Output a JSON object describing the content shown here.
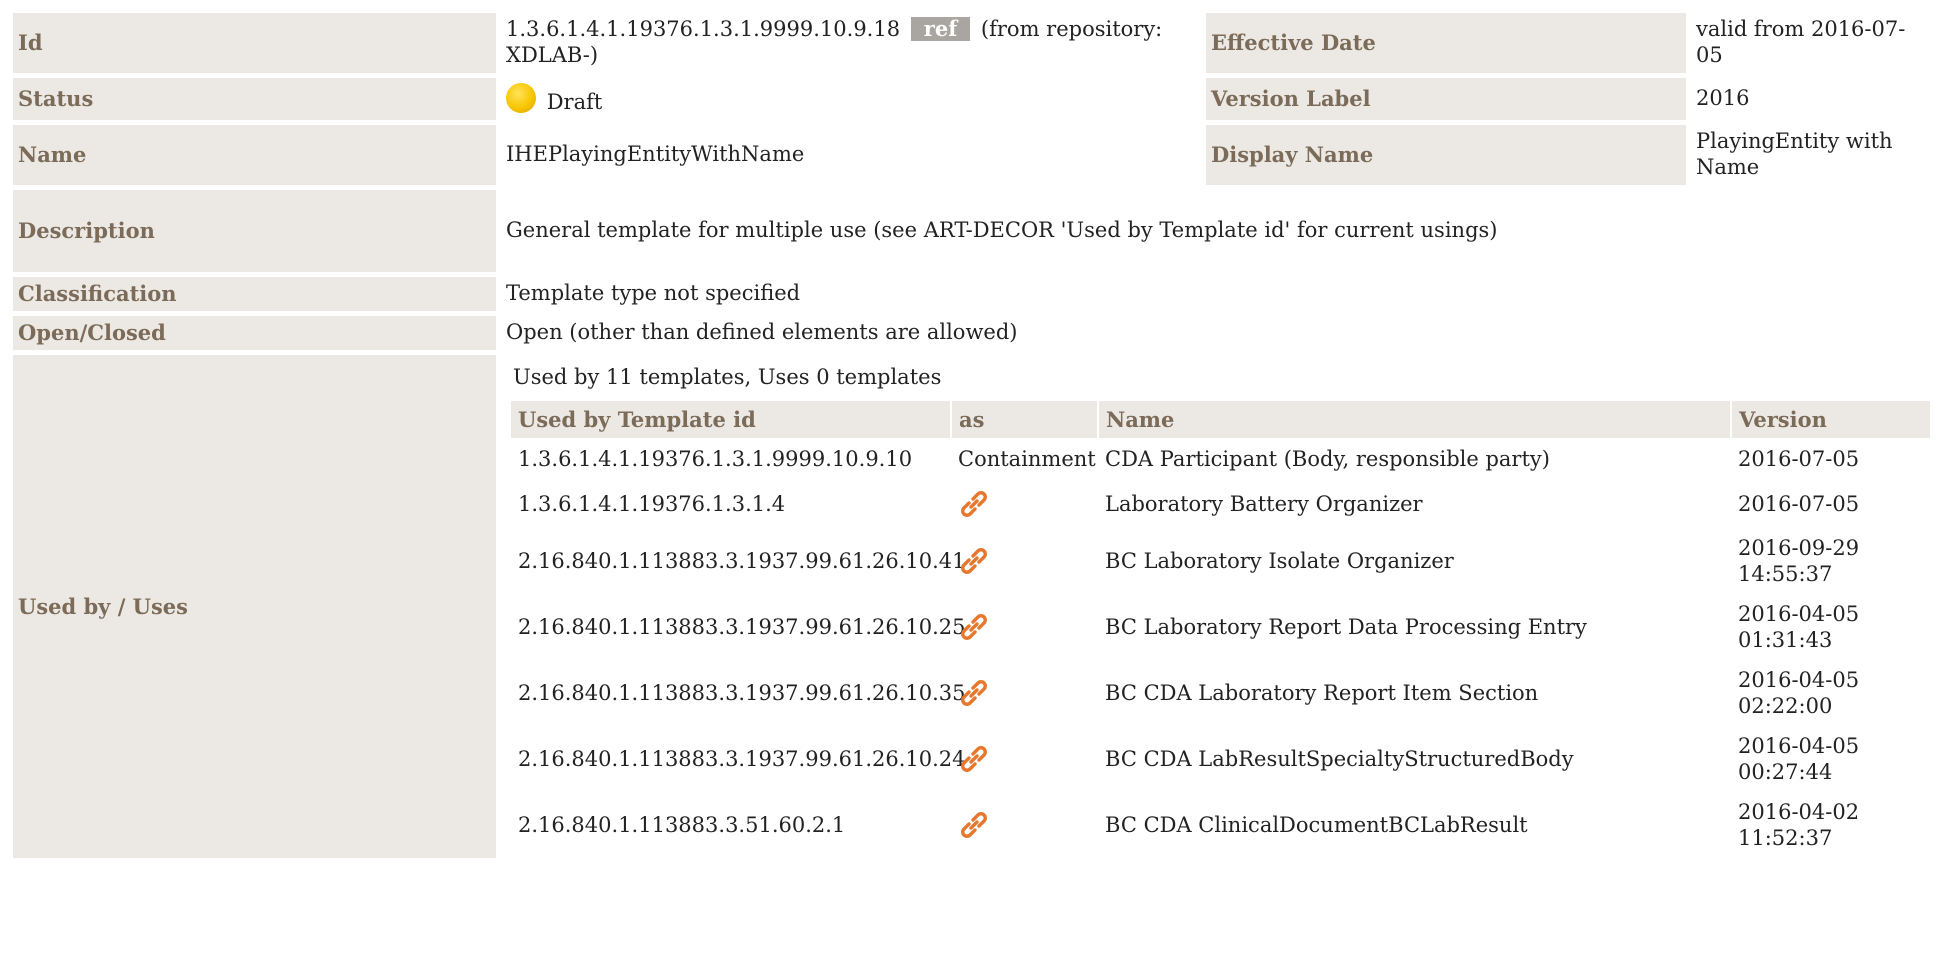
{
  "rows": {
    "id": {
      "label": "Id",
      "value": "1.3.6.1.4.1.19376.1.3.1.9999.10.9.18",
      "badge": "ref",
      "suffix": "(from repository: XDLAB-)"
    },
    "effective_date": {
      "label": "Effective Date",
      "value": "valid from 2016-07-05"
    },
    "status": {
      "label": "Status",
      "value": "Draft",
      "icon": "draft-status-icon",
      "icon_color": "#f7c600"
    },
    "version_label": {
      "label": "Version Label",
      "value": "2016"
    },
    "name": {
      "label": "Name",
      "value": "IHEPlayingEntityWithName"
    },
    "display_name": {
      "label": "Display Name",
      "value": "PlayingEntity with Name"
    },
    "description": {
      "label": "Description",
      "value": "General template for multiple use (see ART-DECOR 'Used by Template id' for current usings)"
    },
    "classification": {
      "label": "Classification",
      "value": "Template type not specified"
    },
    "open_closed": {
      "label": "Open/Closed",
      "value": "Open (other than defined elements are allowed)"
    },
    "used_by": {
      "label": "Used by / Uses",
      "summary": "Used by 11 templates, Uses 0 templates"
    }
  },
  "used_by_table": {
    "headers": {
      "template_id": "Used by Template id",
      "as": "as",
      "name": "Name",
      "version": "Version"
    },
    "link_icon": "link-icon",
    "link_color": "#e8772e",
    "rows": [
      {
        "template_id": "1.3.6.1.4.1.19376.1.3.1.9999.10.9.10",
        "as": "Containment",
        "name": "CDA Participant (Body, responsible party)",
        "version": "2016-07-05"
      },
      {
        "template_id": "1.3.6.1.4.1.19376.1.3.1.4",
        "as": "",
        "name": "Laboratory Battery Organizer",
        "version": "2016-07-05"
      },
      {
        "template_id": "2.16.840.1.113883.3.1937.99.61.26.10.41",
        "as": "",
        "name": "BC Laboratory Isolate Organizer",
        "version": "2016-09-29 14:55:37"
      },
      {
        "template_id": "2.16.840.1.113883.3.1937.99.61.26.10.25",
        "as": "",
        "name": "BC Laboratory Report Data Processing Entry",
        "version": "2016-04-05 01:31:43"
      },
      {
        "template_id": "2.16.840.1.113883.3.1937.99.61.26.10.35",
        "as": "",
        "name": "BC CDA Laboratory Report Item Section",
        "version": "2016-04-05 02:22:00"
      },
      {
        "template_id": "2.16.840.1.113883.3.1937.99.61.26.10.24",
        "as": "",
        "name": "BC CDA LabResultSpecialtyStructuredBody",
        "version": "2016-04-05 00:27:44"
      },
      {
        "template_id": "2.16.840.1.113883.3.51.60.2.1",
        "as": "",
        "name": "BC CDA ClinicalDocumentBCLabResult",
        "version": "2016-04-02 11:52:37"
      }
    ]
  }
}
